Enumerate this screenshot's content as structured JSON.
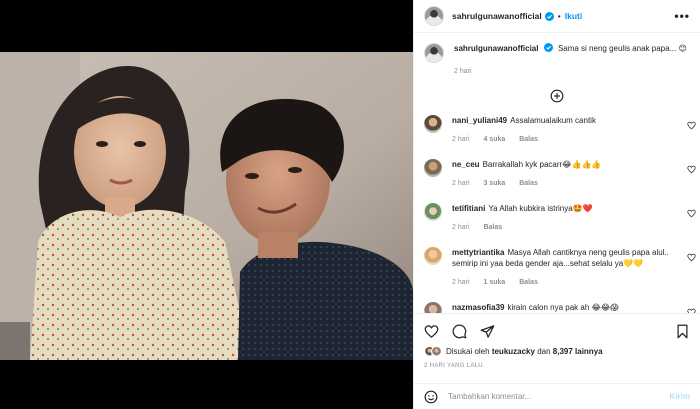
{
  "post": {
    "username": "sahrulgunawanofficial",
    "follow_label": "Ikuti",
    "more_label": "•••",
    "dot": "•",
    "caption": "Sama si neng geulis anak papa... 😊",
    "caption_time": "2 hari"
  },
  "comments": [
    {
      "user": "nani_yuliani49",
      "text": "Assalamualaikum cantik",
      "time": "2 hari",
      "likes": "4 suka",
      "reply": "Balas"
    },
    {
      "user": "ne_ceu",
      "text": "Barrakallah kyk pacarr😂👍👍👍",
      "time": "2 hari",
      "likes": "3 suka",
      "reply": "Balas"
    },
    {
      "user": "tetifitiani",
      "text": "Ya Allah kubkira istrinya🤩❤️",
      "time": "2 hari",
      "likes": "",
      "reply": "Balas"
    },
    {
      "user": "mettytriantika",
      "text": "Masya Allah cantiknya neng geulis papa alul.. semirip ini yaa beda gender aja...sehat selalu ya💛💛",
      "time": "2 hari",
      "likes": "1 suka",
      "reply": "Balas"
    },
    {
      "user": "nazmasofia39",
      "text": "kirain calon nya pak ah 😂😂😱",
      "time": "",
      "likes": "",
      "reply": ""
    }
  ],
  "actions": {
    "liked_by_prefix": "Disukai oleh",
    "liked_by_user": "teukuzacky",
    "liked_by_mid": "dan",
    "liked_by_count": "8,397 lainnya",
    "date": "2 HARI YANG LALU",
    "comment_placeholder": "Tambahkan komentar...",
    "post_label": "Kirim"
  },
  "icons": {
    "like": "heart-icon",
    "comment": "comment-icon",
    "share": "share-icon",
    "save": "bookmark-icon",
    "emoji": "emoji-icon",
    "load_more": "plus-circle-icon",
    "verified": "verified-badge-icon",
    "more": "more-options-icon"
  },
  "colors": {
    "accent": "#0095f6",
    "muted": "#8e8e8e",
    "text": "#262626",
    "post_disabled": "#b2dffc"
  }
}
